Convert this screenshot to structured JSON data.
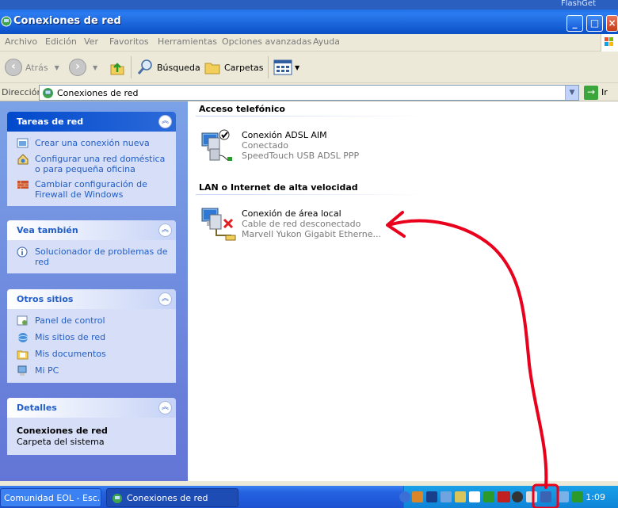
{
  "window": {
    "title": "Conexiones de red",
    "top_strip_label": "FlashGet"
  },
  "menu": {
    "items": [
      "Archivo",
      "Edición",
      "Ver",
      "Favoritos",
      "Herramientas",
      "Opciones avanzadas",
      "Ayuda"
    ]
  },
  "toolbar": {
    "back_label": "Atrás",
    "search_label": "Búsqueda",
    "folders_label": "Carpetas"
  },
  "address": {
    "label": "Dirección",
    "value": "Conexiones de red",
    "go_label": "Ir"
  },
  "sidebar": {
    "network_tasks": {
      "title": "Tareas de red",
      "items": [
        "Crear una conexión nueva",
        "Configurar una red doméstica o para pequeña oficina",
        "Cambiar configuración de Firewall de Windows"
      ]
    },
    "see_also": {
      "title": "Vea también",
      "items": [
        "Solucionador de problemas de red"
      ]
    },
    "other_places": {
      "title": "Otros sitios",
      "items": [
        "Panel de control",
        "Mis sitios de red",
        "Mis documentos",
        "Mi PC"
      ]
    },
    "details": {
      "title": "Detalles",
      "name": "Conexiones de red",
      "type": "Carpeta del sistema"
    }
  },
  "main": {
    "dialup_group": {
      "title": "Acceso telefónico",
      "connection": {
        "name": "Conexión ADSL AIM",
        "status": "Conectado",
        "device": "SpeedTouch USB ADSL PPP"
      }
    },
    "lan_group": {
      "title": "LAN o Internet de alta velocidad",
      "connection": {
        "name": "Conexión de área local",
        "status": "Cable de red desconectado",
        "device": "Marvell Yukon Gigabit Etherne..."
      }
    }
  },
  "taskbar": {
    "buttons": [
      "Comunidad EOL - Esc...",
      "Conexiones de red"
    ],
    "clock": "1:09"
  },
  "colors": {
    "annotation_red": "#e8001c",
    "xp_blue": "#215dc6"
  }
}
